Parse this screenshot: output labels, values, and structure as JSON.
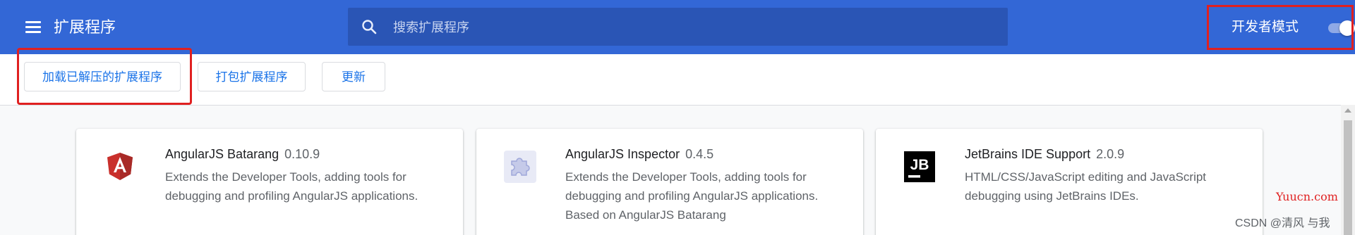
{
  "header": {
    "menu_icon": "hamburger-menu-icon",
    "title": "扩展程序",
    "search": {
      "icon": "search-icon",
      "placeholder": "搜索扩展程序",
      "value": ""
    },
    "developer_mode": {
      "label": "开发者模式",
      "enabled": true
    },
    "color": "#3367d6"
  },
  "toolbar": {
    "load_unpacked": "加载已解压的扩展程序",
    "pack_extension": "打包扩展程序",
    "update": "更新"
  },
  "extensions": [
    {
      "name": "AngularJS Batarang",
      "version": "0.10.9",
      "icon": "angularjs-shield-icon",
      "description": "Extends the Developer Tools, adding tools for debugging and profiling AngularJS applications."
    },
    {
      "name": "AngularJS Inspector",
      "version": "0.4.5",
      "icon": "puzzle-piece-icon",
      "description": "Extends the Developer Tools, adding tools for debugging and profiling AngularJS applications. Based on AngularJS Batarang"
    },
    {
      "name": "JetBrains IDE Support",
      "version": "2.0.9",
      "icon": "jetbrains-jb-icon",
      "description": "HTML/CSS/JavaScript editing and JavaScript debugging using JetBrains IDEs."
    }
  ],
  "watermarks": {
    "site": "Yuucn.com",
    "author": "CSDN @清风 与我"
  },
  "accent_colors": {
    "link_blue": "#1a73e8",
    "highlight_red": "#e02020"
  }
}
